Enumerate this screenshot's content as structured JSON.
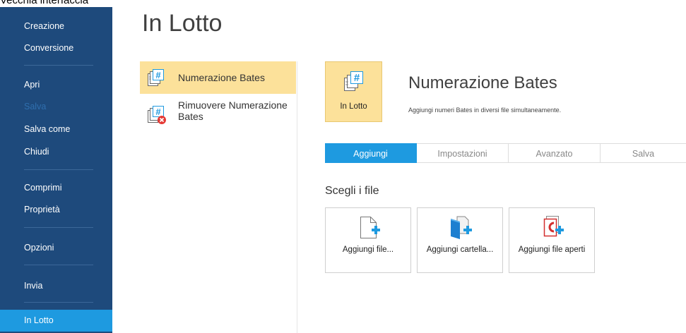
{
  "caption": "Vecchia interfaccia",
  "sidebar": {
    "items": [
      {
        "label": "Creazione",
        "state": "normal"
      },
      {
        "label": "Conversione",
        "state": "normal"
      },
      {
        "label": "Apri",
        "state": "normal"
      },
      {
        "label": "Salva",
        "state": "disabled"
      },
      {
        "label": "Salva come",
        "state": "normal"
      },
      {
        "label": "Chiudi",
        "state": "normal"
      },
      {
        "label": "Comprimi",
        "state": "normal"
      },
      {
        "label": "Proprietà",
        "state": "normal"
      },
      {
        "label": "Opzioni",
        "state": "normal"
      },
      {
        "label": "Invia",
        "state": "normal"
      },
      {
        "label": "In Lotto",
        "state": "active"
      }
    ]
  },
  "page_title": "In Lotto",
  "commands": [
    {
      "label": "Numerazione Bates",
      "selected": true,
      "icon": "bates-number-icon"
    },
    {
      "label": "Rimuovere Numerazione Bates",
      "selected": false,
      "icon": "bates-remove-icon"
    }
  ],
  "feature": {
    "button_label": "In Lotto",
    "title": "Numerazione Bates",
    "description": "Aggiungi numeri Bates in diversi file simultaneamente."
  },
  "tabs": [
    {
      "label": "Aggiungi",
      "active": true
    },
    {
      "label": "Impostazioni",
      "active": false
    },
    {
      "label": "Avanzato",
      "active": false
    },
    {
      "label": "Salva",
      "active": false
    }
  ],
  "files_section": {
    "title": "Scegli i file",
    "buttons": [
      {
        "label": "Aggiungi file...",
        "icon": "add-file-icon"
      },
      {
        "label": "Aggiungi cartella...",
        "icon": "add-folder-icon"
      },
      {
        "label": "Aggiungi file aperti",
        "icon": "add-open-files-icon"
      }
    ]
  },
  "colors": {
    "sidebar_bg": "#1e4a7c",
    "accent": "#1e9ae0",
    "selection": "#fce19a",
    "remove_badge": "#e53935",
    "open_file_icon": "#d32f2f"
  }
}
